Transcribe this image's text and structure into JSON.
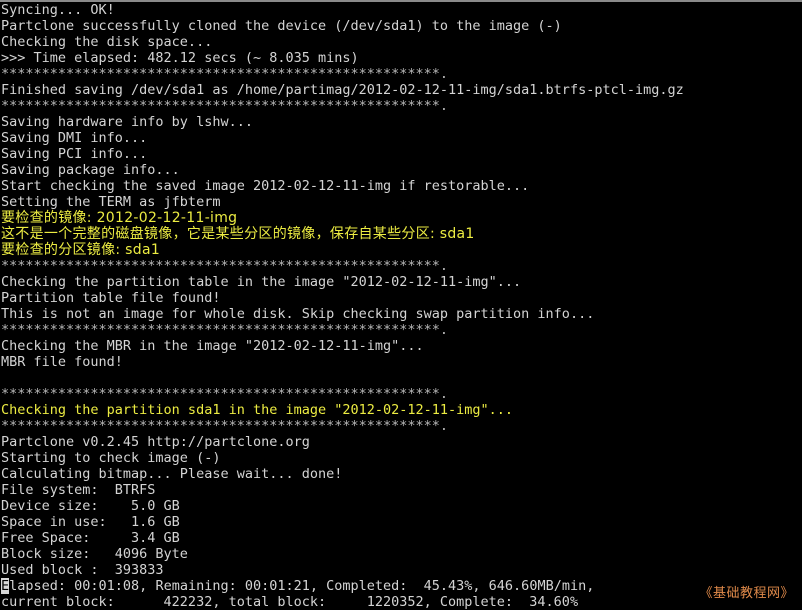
{
  "terminal": {
    "title": "Clonezilla partclone image check console",
    "colors": {
      "background": "#000000",
      "default_text": "#cfcfcf",
      "highlight_text": "#ecec42",
      "separator_rule": "#8a8a8a",
      "cursor": "#d8d8d8",
      "watermark": "#e08a4a"
    },
    "cursor": {
      "character": "E",
      "line_index": 35,
      "column": 0
    },
    "lines": [
      {
        "text": "Syncing... OK!",
        "color": "white"
      },
      {
        "text": "Partclone successfully cloned the device (/dev/sda1) to the image (-)",
        "color": "white"
      },
      {
        "text": "Checking the disk space...",
        "color": "white"
      },
      {
        "text": ">>> Time elapsed: 482.12 secs (~ 8.035 mins)",
        "color": "white"
      },
      {
        "text": "******************************************************.",
        "color": "stars"
      },
      {
        "text": "Finished saving /dev/sda1 as /home/partimag/2012-02-12-11-img/sda1.btrfs-ptcl-img.gz",
        "color": "white"
      },
      {
        "text": "******************************************************.",
        "color": "stars"
      },
      {
        "text": "Saving hardware info by lshw...",
        "color": "white"
      },
      {
        "text": "Saving DMI info...",
        "color": "white"
      },
      {
        "text": "Saving PCI info...",
        "color": "white"
      },
      {
        "text": "Saving package info...",
        "color": "white"
      },
      {
        "text": "Start checking the saved image 2012-02-12-11-img if restorable...",
        "color": "white"
      },
      {
        "text": "Setting the TERM as jfbterm",
        "color": "white"
      },
      {
        "text": "要检查的镜像: 2012-02-12-11-img",
        "color": "yellow",
        "cjk": true
      },
      {
        "text": "这不是一个完整的磁盘镜像，它是某些分区的镜像，保存自某些分区: sda1",
        "color": "yellow",
        "cjk": true
      },
      {
        "text": "要检查的分区镜像: sda1",
        "color": "yellow",
        "cjk": true
      },
      {
        "text": "******************************************************.",
        "color": "stars"
      },
      {
        "text": "Checking the partition table in the image \"2012-02-12-11-img\"...",
        "color": "white"
      },
      {
        "text": "Partition table file found!",
        "color": "white"
      },
      {
        "text": "This is not an image for whole disk. Skip checking swap partition info...",
        "color": "white"
      },
      {
        "text": "******************************************************.",
        "color": "stars"
      },
      {
        "text": "Checking the MBR in the image \"2012-02-12-11-img\"...",
        "color": "white"
      },
      {
        "text": "MBR file found!",
        "color": "white"
      },
      {
        "text": "",
        "color": "white"
      },
      {
        "text": "******************************************************.",
        "color": "stars"
      },
      {
        "text": "Checking the partition sda1 in the image \"2012-02-12-11-img\"...",
        "color": "yellow"
      },
      {
        "text": "******************************************************.",
        "color": "stars"
      },
      {
        "text": "Partclone v0.2.45 http://partclone.org",
        "color": "white"
      },
      {
        "text": "Starting to check image (-)",
        "color": "white"
      },
      {
        "text": "Calculating bitmap... Please wait... done!",
        "color": "white"
      },
      {
        "text": "File system:  BTRFS",
        "color": "white"
      },
      {
        "text": "Device size:    5.0 GB",
        "color": "white"
      },
      {
        "text": "Space in use:   1.6 GB",
        "color": "white"
      },
      {
        "text": "Free Space:     3.4 GB",
        "color": "white"
      },
      {
        "text": "Block size:   4096 Byte",
        "color": "white"
      },
      {
        "text": "Used block :  393833",
        "color": "white"
      },
      {
        "text": "Elapsed: 00:01:08, Remaining: 00:01:21, Completed:  45.43%, 646.60MB/min,",
        "color": "white",
        "cursor_first_char": true
      },
      {
        "text": "current block:      422232, total block:     1220352, Complete:  34.60%",
        "color": "white"
      }
    ],
    "partclone_stats": {
      "version": "v0.2.45",
      "url": "http://partclone.org",
      "file_system": "BTRFS",
      "device_size": "5.0 GB",
      "space_in_use": "1.6 GB",
      "free_space": "3.4 GB",
      "block_size": "4096 Byte",
      "used_block": "393833",
      "elapsed": "00:01:08",
      "remaining": "00:01:21",
      "completed_percent": "45.43%",
      "rate": "646.60MB/min",
      "current_block": "422232",
      "total_block": "1220352",
      "complete_percent": "34.60%"
    },
    "image_name": "2012-02-12-11-img",
    "source_device": "/dev/sda1",
    "image_file": "/home/partimag/2012-02-12-11-img/sda1.btrfs-ptcl-img.gz",
    "time_elapsed_secs": "482.12",
    "time_elapsed_mins": "8.035"
  },
  "watermark": {
    "text": "《基础教程网》"
  }
}
